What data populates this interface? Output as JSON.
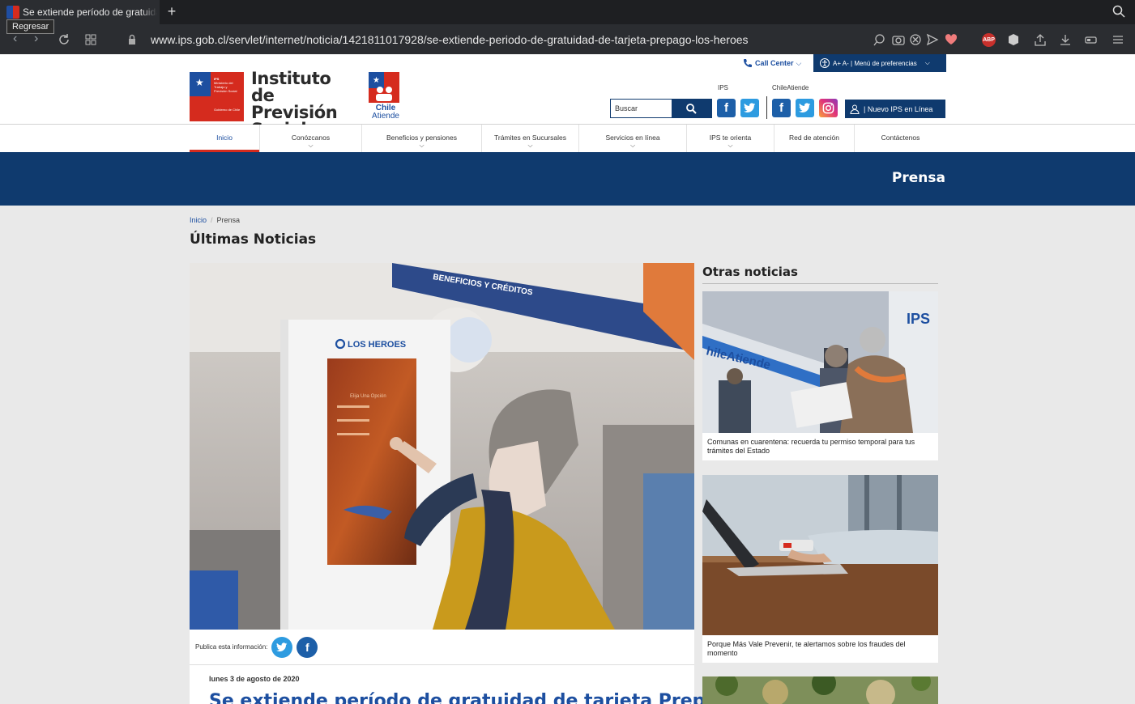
{
  "browser": {
    "tab_title": "Se extiende período de gratuidad de tarjeta Prepago Los Héroes",
    "tooltip": "Regresar",
    "url": "www.ips.gob.cl/servlet/internet/noticia/1421811017928/se-extiende-periodo-de-gratuidad-de-tarjeta-prepago-los-heroes",
    "adblock_label": "ABP"
  },
  "header": {
    "logo_small_lines": [
      "IPS",
      "Ministerio del Trabajo y Previsión Social",
      "Gobierno de Chile"
    ],
    "logo_text": "Instituto de Previsión Social",
    "chileatiende_logo": [
      "Chile",
      "Atiende"
    ],
    "call_center": "Call Center",
    "preferences": "A+ A- | Menú de preferencias",
    "search_placeholder": "Buscar",
    "ips_label": "IPS",
    "chileatiende_label": "ChileAtiende",
    "nuevo_ips": "| Nuevo IPS en Línea"
  },
  "nav": {
    "items": [
      {
        "label": "Inicio",
        "active": true
      },
      {
        "label": "Conózcanos",
        "dropdown": true
      },
      {
        "label": "Beneficios y pensiones",
        "dropdown": true
      },
      {
        "label": "Trámites en Sucursales",
        "dropdown": true
      },
      {
        "label": "Servicios en línea",
        "dropdown": true
      },
      {
        "label": "IPS te orienta",
        "dropdown": true
      },
      {
        "label": "Red de atención",
        "dropdown": false
      },
      {
        "label": "Contáctenos",
        "dropdown": false
      }
    ]
  },
  "band_title": "Prensa",
  "breadcrumb": {
    "home": "Inicio",
    "current": "Prensa"
  },
  "page_title": "Últimas Noticias",
  "hero": {
    "kiosk_brand": "LOS HEROES",
    "kiosk_screen_title": "Elija Una Opción",
    "banner_text": "BENEFICIOS Y CRÉDITOS",
    "share_label": "Publica esta información:",
    "date": "lunes 3 de agosto de 2020",
    "headline": "Se extiende período de gratuidad de tarjeta Prepago"
  },
  "side": {
    "title": "Otras noticias",
    "cards": [
      {
        "caption": "Comunas en cuarentena: recuerda tu permiso temporal para tus trámites del Estado",
        "sign_text": "hileAtiende",
        "ips_text": "IPS"
      },
      {
        "caption": "Porque Más Vale Prevenir, te alertamos sobre los fraudes del momento"
      },
      {
        "caption": ""
      }
    ]
  },
  "colors": {
    "navy": "#0f3a6e",
    "red": "#d52b1e",
    "blue": "#1d4fa0"
  }
}
